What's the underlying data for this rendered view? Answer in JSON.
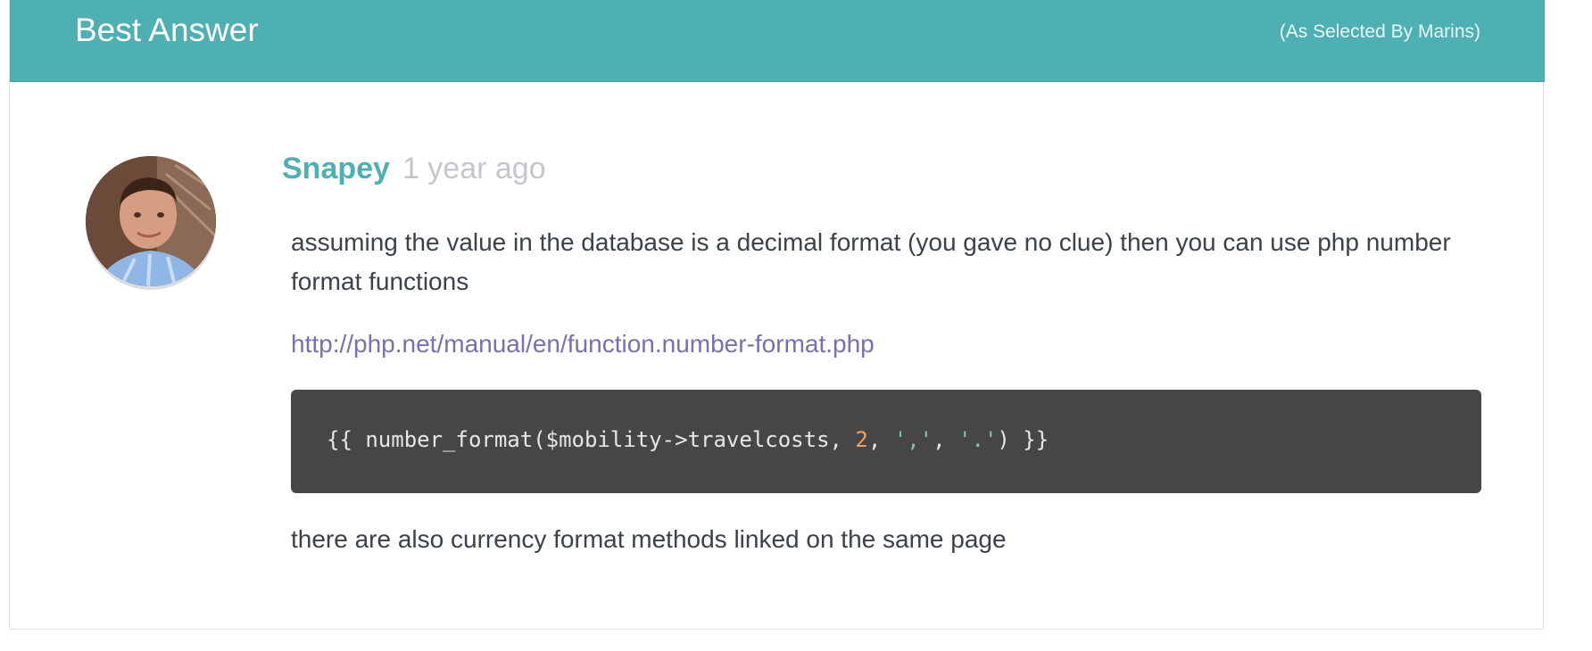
{
  "header": {
    "title": "Best Answer",
    "selected_by": "(As Selected By Marins)",
    "color": "#4eb0b3"
  },
  "answer": {
    "author": "Snapey",
    "time": "1 year ago",
    "avatar_icon": "user-avatar-photo",
    "paragraph": "assuming the value in the database is a decimal format (you gave no clue) then you can use php number format functions",
    "link": "http://php.net/manual/en/function.number-format.php",
    "code": {
      "prefix": "{{ number_format($mobility->travelcosts, ",
      "number": "2",
      "sep1": ", ",
      "str1": "','",
      "sep2": ", ",
      "str2": "'.'",
      "suffix": ") }}"
    },
    "footer_text": "there are also currency format methods linked on the same page"
  }
}
